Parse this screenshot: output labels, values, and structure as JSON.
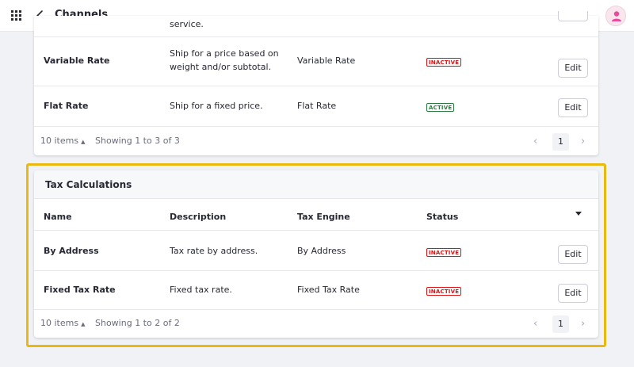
{
  "header": {
    "title": "Channels",
    "apps_icon": "apps-grid-icon",
    "back_icon": "chevron-left-icon",
    "avatar_icon": "user-icon"
  },
  "shipping": {
    "partial_desc": "service.",
    "rows": [
      {
        "name": "Variable Rate",
        "description": "Ship for a price based on weight and/or subtotal.",
        "engine": "Variable Rate",
        "status": "INACTIVE",
        "edit": "Edit"
      },
      {
        "name": "Flat Rate",
        "description": "Ship for a fixed price.",
        "engine": "Flat Rate",
        "status": "ACTIVE",
        "edit": "Edit"
      }
    ],
    "pagination": {
      "per_page": "10 items",
      "showing": "Showing 1 to 3 of 3",
      "page": "1"
    }
  },
  "tax": {
    "title": "Tax Calculations",
    "columns": {
      "name": "Name",
      "description": "Description",
      "engine": "Tax Engine",
      "status": "Status"
    },
    "rows": [
      {
        "name": "By Address",
        "description": "Tax rate by address.",
        "engine": "By Address",
        "status": "INACTIVE",
        "edit": "Edit"
      },
      {
        "name": "Fixed Tax Rate",
        "description": "Fixed tax rate.",
        "engine": "Fixed Tax Rate",
        "status": "INACTIVE",
        "edit": "Edit"
      }
    ],
    "pagination": {
      "per_page": "10 items",
      "showing": "Showing 1 to 2 of 2",
      "page": "1"
    }
  },
  "colors": {
    "highlight": "#e9b90f",
    "inactive": "#da1414",
    "active": "#287d3c",
    "avatar": "#e94a9b"
  }
}
